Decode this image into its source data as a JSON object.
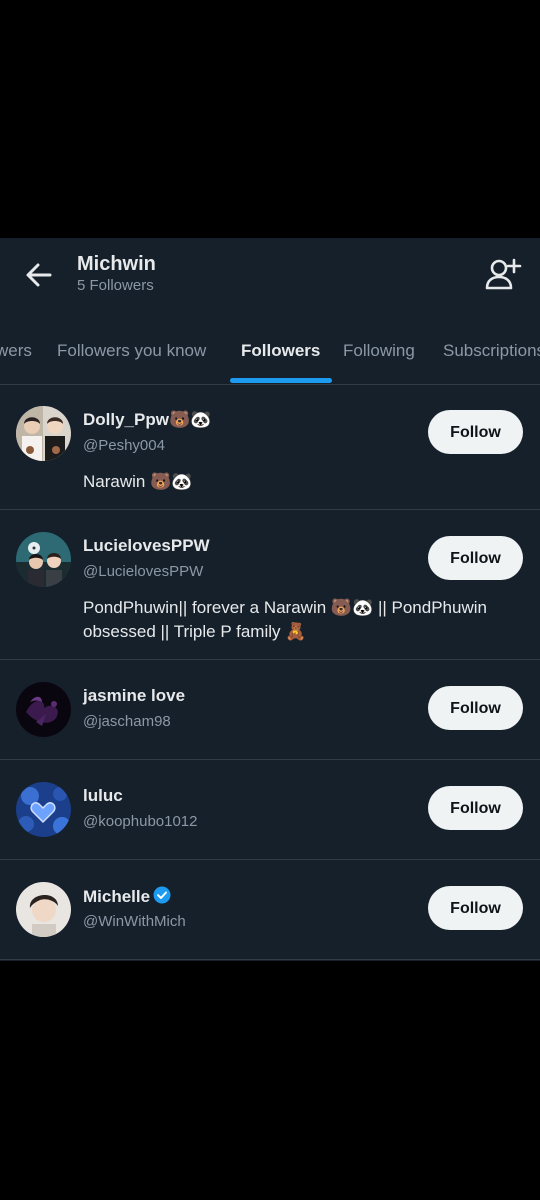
{
  "header": {
    "title": "Michwin",
    "subtitle": "5 Followers"
  },
  "tabs": [
    {
      "label": "wers"
    },
    {
      "label": "Followers you know"
    },
    {
      "label": "Followers",
      "active": true
    },
    {
      "label": "Following"
    },
    {
      "label": "Subscriptions"
    }
  ],
  "follow_label": "Follow",
  "users": [
    {
      "name": "Dolly_Ppw🐻🐼",
      "handle": "@Peshy004",
      "bio_lines": [
        "Narawin 🐻🐼"
      ],
      "avatar": "photo-two-people"
    },
    {
      "name": "LucielovesPPW",
      "handle": "@LucielovesPPW",
      "bio_lines": [
        "PondPhuwin|| forever a Narawin 🐻🐼 || PondPhuwin",
        "obsessed ||  Triple P family 🧸"
      ],
      "avatar": "photo-group"
    },
    {
      "name": "jasmine love",
      "handle": "@jascham98",
      "bio_lines": [],
      "avatar": "dark-purple-art"
    },
    {
      "name": "luluc",
      "handle": "@koophubo1012",
      "bio_lines": [],
      "avatar": "blue-heart-art"
    },
    {
      "name": "Michelle",
      "handle": "@WinWithMich",
      "bio_lines": [],
      "verified": true,
      "avatar": "photo-portrait"
    }
  ],
  "colors": {
    "background": "#15202b",
    "accent": "#1d9bf0",
    "secondary_text": "#8b98a5",
    "button_bg": "#eff3f4"
  }
}
